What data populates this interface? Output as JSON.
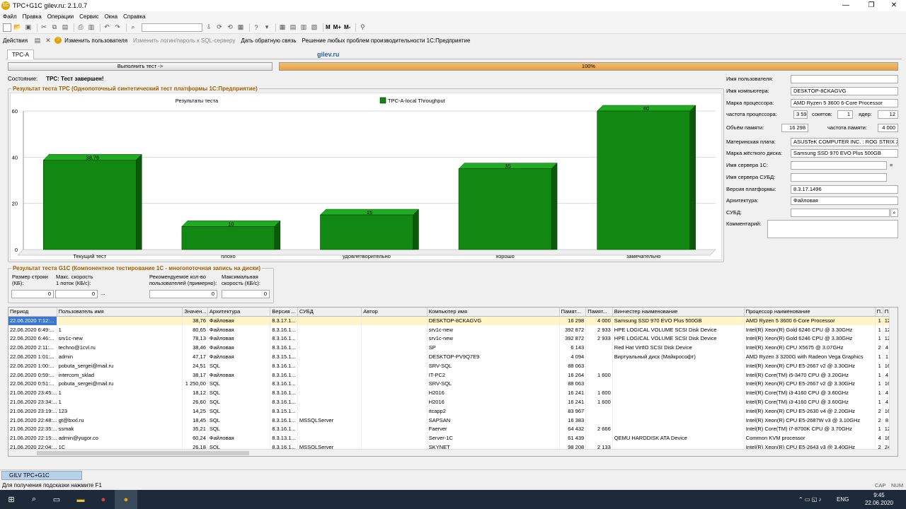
{
  "window": {
    "title": "TPC+G1C gilev.ru: 2.1.0.7"
  },
  "menu": [
    "Файл",
    "Правка",
    "Операции",
    "Сервис",
    "Окна",
    "Справка"
  ],
  "actions": {
    "actions_label": "Действия",
    "change_user": "Изменить пользователя",
    "change_login": "Изменить логин/пароль к SQL-серверу",
    "feedback": "Дать обратную связь",
    "solve": "Решение любых проблем производительности 1С:Предприятие"
  },
  "toolbar": {
    "m": "М",
    "mplus": "М+",
    "mminus": "М-"
  },
  "tab": {
    "label": "TPC-A",
    "brand": "gilev.ru"
  },
  "run_button": "Выполнить тест ->",
  "progress": {
    "value": 1.0,
    "label": "100%"
  },
  "state": {
    "label": "Состояние:",
    "value": "TPC: Тест завершен!"
  },
  "tpc_group_title": "Результат теста TPC (Однопоточный синтетический тест платформы 1С:Предприятие)",
  "chart_data": {
    "type": "bar",
    "title": "Результаты теста",
    "categories": [
      "Текущий тест",
      "плохо",
      "удовлетворительно",
      "хорошо",
      "замечательно"
    ],
    "series": [
      {
        "name": "TPC-A-local Throughput",
        "values": [
          38.76,
          10,
          15,
          35,
          60
        ],
        "color": "#118811"
      }
    ],
    "data_labels": [
      "38,76",
      "10",
      "15",
      "35",
      "60"
    ],
    "yticks": [
      "0",
      "20",
      "40",
      "60"
    ],
    "ylim": [
      0,
      60
    ],
    "grid": true,
    "legend_position": "top"
  },
  "g1c": {
    "title": "Результат теста G1C (Компонентное тестирование 1С - многопоточная запись на диски)",
    "row_size_label": "Размер строки (КБ):",
    "max_speed_label": "Макс. скорость 1 поток (КБ/с):",
    "rec_users_label": "Рекомендуемое кол-во пользователей (примерно):",
    "max_speed2_label": "Максимальная скорость (КБ/с):",
    "row_size": "0",
    "max_speed": "0",
    "rec_users": "0",
    "max_speed2": "0",
    "dots": "..."
  },
  "info": {
    "user_label": "Имя пользователя:",
    "user": "",
    "computer_label": "Имя компьютера:",
    "computer": "DESKTOP-8CKAGVG",
    "cpu_label": "Марка процессора:",
    "cpu": "AMD Ryzen 5 3600 6-Core Processor",
    "freq_label": "частота процессора:",
    "freq": "3 593",
    "sockets_label": "сокетов:",
    "sockets": "1",
    "cores_label": "ядер:",
    "cores": "12",
    "mem_label": "Объём памяти:",
    "mem": "16 298",
    "memfreq_label": "частота памяти:",
    "memfreq": "4 000",
    "mb_label": "Материнская плата:",
    "mb": "ASUSTeK COMPUTER INC. : ROG STRIX X5",
    "disk_label": "Марка жёсткого диска:",
    "disk": "Samsung SSD 970 EVO Plus 500GB",
    "server1c_label": "Имя сервера 1С:",
    "server1c": "",
    "eq": "=",
    "dbserver_label": "Имя сервера СУБД:",
    "dbserver": "",
    "platform_label": "Версия платформы:",
    "platform": "8.3.17.1496",
    "arch_label": "Архитектура:",
    "arch": "Файловая",
    "dbms_label": "СУБД:",
    "dbms": "",
    "comment_label": "Комментарий:",
    "comment": ""
  },
  "grid": {
    "columns": [
      "Период",
      "Пользователь имя",
      "Значен...",
      "Архитектура",
      "Версия ...",
      "СУБД",
      "Автор",
      "Компьютер имя",
      "Памят...",
      "Памят...",
      "Винчестер наименование",
      "Процессор наименование",
      "П...",
      "П..."
    ],
    "rows": [
      [
        "22.06.2020 7:12:...",
        "",
        "38,76",
        "Файловая",
        "8.3.17.1...",
        "",
        "",
        "DESKTOP-8CKAGVG",
        "16 298",
        "4 000",
        "Samsung SSD 970 EVO Plus 500GB",
        "AMD Ryzen 5 3600 6-Core Processor",
        "1",
        "12"
      ],
      [
        "22.06.2020 6:49:...",
        "1",
        "80,65",
        "Файловая",
        "8.3.16.1...",
        "",
        "",
        "srv1c-new",
        "392 872",
        "2 933",
        "HPE LOGICAL VOLUME SCSI Disk Device",
        "Intel(R) Xeon(R) Gold 6246 CPU @ 3.30GHz",
        "1",
        "12"
      ],
      [
        "22.06.2020 6:46:...",
        "srv1c-new",
        "78,13",
        "Файловая",
        "8.3.16.1...",
        "",
        "",
        "srv1c-new",
        "392 872",
        "2 933",
        "HPE LOGICAL VOLUME SCSI Disk Device",
        "Intel(R) Xeon(R) Gold 6246 CPU @ 3.30GHz",
        "1",
        "12"
      ],
      [
        "22.06.2020 2:11:...",
        "techno@1cvl.ru",
        "38,46",
        "Файловая",
        "8.3.16.1...",
        "",
        "",
        "SP",
        "6 143",
        "",
        "Red Hat VirtIO SCSI Disk Device",
        "Intel(R) Xeon(R) CPU        X5675  @ 3.07GHz",
        "2",
        "4"
      ],
      [
        "22.06.2020 1:01:...",
        "admin",
        "47,17",
        "Файловая",
        "8.3.15.1...",
        "",
        "",
        "DESKTOP-PV9Q7E9",
        "4 094",
        "",
        "Виртуальный диск (Майкрософт)",
        "AMD Ryzen 3 3200G with Radeon Vega Graphics",
        "1",
        "1"
      ],
      [
        "22.06.2020 1:00:...",
        "pobuta_sergei@mail.ru",
        "24,51",
        "SQL",
        "8.3.16.1...",
        "",
        "",
        "SRV-SQL",
        "88 063",
        "",
        "",
        "Intel(R) Xeon(R) CPU E5-2667 v2 @ 3.30GHz",
        "1",
        "16"
      ],
      [
        "22.06.2020 0:59:...",
        "intercom_sklad",
        "38,17",
        "Файловая",
        "8.3.16.1...",
        "",
        "",
        "IT-PC2",
        "16 264",
        "1 600",
        "",
        "Intel(R) Core(TM) i5-3470 CPU @ 3.20GHz",
        "1",
        "4"
      ],
      [
        "22.06.2020 0:51:...",
        "pobuta_sergei@mail.ru",
        "1 250,00",
        "SQL",
        "8.3.16.1...",
        "",
        "",
        "SRV-SQL",
        "88 063",
        "",
        "",
        "Intel(R) Xeon(R) CPU E5-2667 v2 @ 3.30GHz",
        "1",
        "16"
      ],
      [
        "21.06.2020 23:45:...",
        "1",
        "18,12",
        "SQL",
        "8.3.16.1...",
        "",
        "",
        "H2016",
        "16 241",
        "1 600",
        "",
        "Intel(R) Core(TM) i3-4160 CPU @ 3.60GHz",
        "1",
        "4"
      ],
      [
        "21.06.2020 23:34:...",
        "1",
        "26,60",
        "SQL",
        "8.3.16.1...",
        "",
        "",
        "H2016",
        "16 241",
        "1 600",
        "",
        "Intel(R) Core(TM) i3-4160 CPU @ 3.60GHz",
        "1",
        "4"
      ],
      [
        "21.06.2020 23:19:...",
        "123",
        "14,25",
        "SQL",
        "8.3.15.1...",
        "",
        "",
        "itcapp2",
        "83 967",
        "",
        "",
        "Intel(R) Xeon(R) CPU E5-2630 v4 @ 2.20GHz",
        "2",
        "16"
      ],
      [
        "21.06.2020 22:48:...",
        "gt@bxxl.ru",
        "18,45",
        "SQL",
        "8.3.16.1...",
        "MSSQLServer",
        "",
        "SAPSAN",
        "16 383",
        "",
        "",
        "Intel(R) Xeon(R) CPU E5-2687W v3 @ 3.10GHz",
        "2",
        "8"
      ],
      [
        "21.06.2020 22:35:...",
        "ssmak",
        "35,21",
        "SQL",
        "8.3.16.1...",
        "",
        "",
        "Faerver",
        "64 432",
        "2 666",
        "",
        "Intel(R) Core(TM) i7-8700K CPU @ 3.70GHz",
        "1",
        "12"
      ],
      [
        "21.06.2020 22:15:...",
        "admin@yugor.co",
        "60,24",
        "Файловая",
        "8.3.13.1...",
        "",
        "",
        "Server-1C",
        "61 439",
        "",
        "QEMU HARDDISK ATA Device",
        "Common KVM processor",
        "4",
        "16"
      ],
      [
        "21.06.2020 22:04:...",
        "1C",
        "26,18",
        "SQL",
        "8.3.16.1...",
        "MSSQLServer",
        "",
        "SKYNET",
        "98 208",
        "2 133",
        "",
        "Intel(R) Xeon(R) CPU E5-2643 v3 @ 3.40GHz",
        "2",
        "24"
      ]
    ]
  },
  "windowbar": {
    "tab": "GILV TPC+G1C"
  },
  "status": {
    "hint": "Для получения подсказки нажмите F1",
    "cap": "CAP",
    "num": "NUM"
  },
  "taskbar": {
    "lang": "ENG",
    "time": "9:45",
    "date": "22.06.2020"
  }
}
